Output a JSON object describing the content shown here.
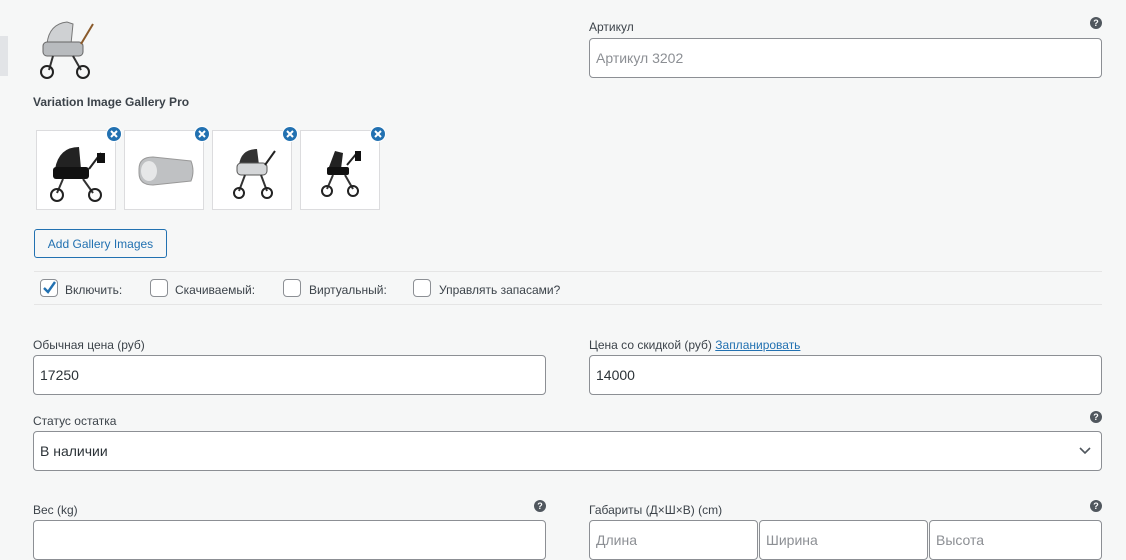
{
  "variation": {
    "main_image_alt": "stroller"
  },
  "sku": {
    "label": "Артикул",
    "placeholder": "Артикул 3202",
    "help_icon": "question-icon"
  },
  "gallery": {
    "title": "Variation Image Gallery Pro",
    "images": [
      "stroller-black",
      "footmuff-grey",
      "stroller-grey-cradle",
      "stroller-black-seat"
    ],
    "add_button": "Add Gallery Images"
  },
  "options": {
    "enable": {
      "label": "Включить:",
      "checked": true
    },
    "downloadable": {
      "label": "Скачиваемый:",
      "checked": false
    },
    "virtual": {
      "label": "Виртуальный:",
      "checked": false
    },
    "manage_stock": {
      "label": "Управлять запасами?",
      "checked": false
    }
  },
  "pricing": {
    "regular_label": "Обычная цена (руб)",
    "regular_value": "17250",
    "sale_label": "Цена со скидкой (руб)",
    "schedule_link": "Запланировать",
    "sale_value": "14000"
  },
  "stock": {
    "label": "Статус остатка",
    "value": "В наличии"
  },
  "weight": {
    "label": "Вес (kg)"
  },
  "dimensions": {
    "label": "Габариты (Д×Ш×В) (cm)",
    "length_placeholder": "Длина",
    "width_placeholder": "Ширина",
    "height_placeholder": "Высота"
  },
  "colors": {
    "accent": "#2271b1",
    "border": "#8c8f94",
    "background": "#f6f7f7"
  }
}
